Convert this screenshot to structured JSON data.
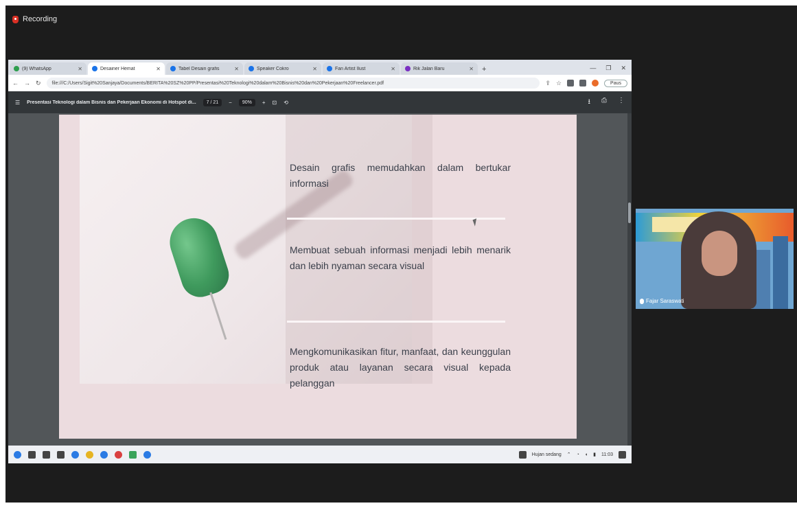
{
  "recording": {
    "label": "Recording"
  },
  "browser": {
    "tabs": [
      {
        "title": "(9) WhatsApp"
      },
      {
        "title": "Desainer Hemat"
      },
      {
        "title": "Tabel Desain grafis"
      },
      {
        "title": "Speaker Cokro"
      },
      {
        "title": "Fan Artist Ilust"
      },
      {
        "title": "Rik Jalan Baru"
      }
    ],
    "url": "file:///C:/Users/Sigit%20Sanjaya/Documents/BERITA%20SZ%20PP/Presentasi%20Teknologi%20dalam%20Bisnis%20dan%20Pekerjaan%20Freelancer.pdf",
    "profile_label": "Paus"
  },
  "pdf": {
    "title": "Presentasi Teknologi dalam Bisnis dan Pekerjaan Ekonomi di Hotspot di...",
    "page_indicator": "7 / 21",
    "zoom": "90%"
  },
  "slide": {
    "point1": "Desain grafis memudahkan dalam bertukar informasi",
    "point2": "Membuat sebuah informasi menjadi lebih menarik dan lebih nyaman secara visual",
    "point3": "Mengkomunikasikan fitur, manfaat, dan keunggulan produk atau layanan secara visual kepada pelanggan"
  },
  "taskbar": {
    "weather": "Hujan sedang",
    "time": "11:03"
  },
  "participant": {
    "name": "Fajar Saraswati"
  }
}
